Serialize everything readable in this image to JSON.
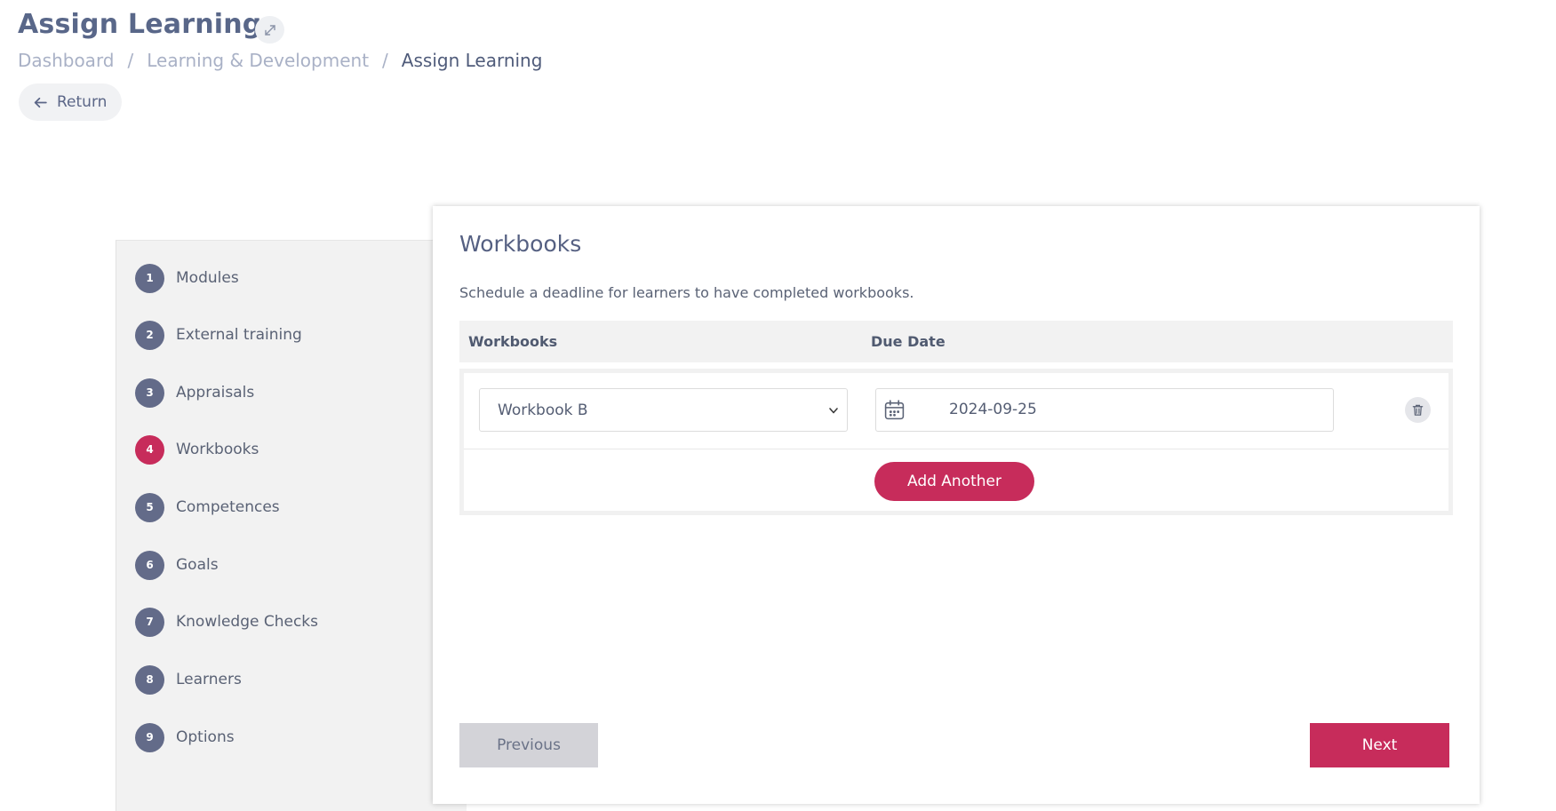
{
  "header": {
    "title": "Assign Learning",
    "expand_icon": "expand-arrows-icon"
  },
  "breadcrumb": {
    "items": [
      "Dashboard",
      "Learning & Development",
      "Assign Learning"
    ],
    "separator": "/"
  },
  "return_button": {
    "label": "Return",
    "icon": "arrow-left-icon"
  },
  "steps": [
    {
      "number": "1",
      "label": "Modules",
      "active": false
    },
    {
      "number": "2",
      "label": "External training",
      "active": false
    },
    {
      "number": "3",
      "label": "Appraisals",
      "active": false
    },
    {
      "number": "4",
      "label": "Workbooks",
      "active": true
    },
    {
      "number": "5",
      "label": "Competences",
      "active": false
    },
    {
      "number": "6",
      "label": "Goals",
      "active": false
    },
    {
      "number": "7",
      "label": "Knowledge Checks",
      "active": false
    },
    {
      "number": "8",
      "label": "Learners",
      "active": false
    },
    {
      "number": "9",
      "label": "Options",
      "active": false
    }
  ],
  "panel": {
    "title": "Workbooks",
    "description": "Schedule a deadline for learners to have completed workbooks.",
    "columns": [
      "Workbooks",
      "Due Date"
    ],
    "rows": [
      {
        "workbook": "Workbook B",
        "due_date": "2024-09-25"
      }
    ],
    "add_button": "Add Another",
    "previous_button": "Previous",
    "next_button": "Next"
  },
  "colors": {
    "accent": "#c72c5b",
    "step_default": "#636b89",
    "title": "#596789"
  }
}
